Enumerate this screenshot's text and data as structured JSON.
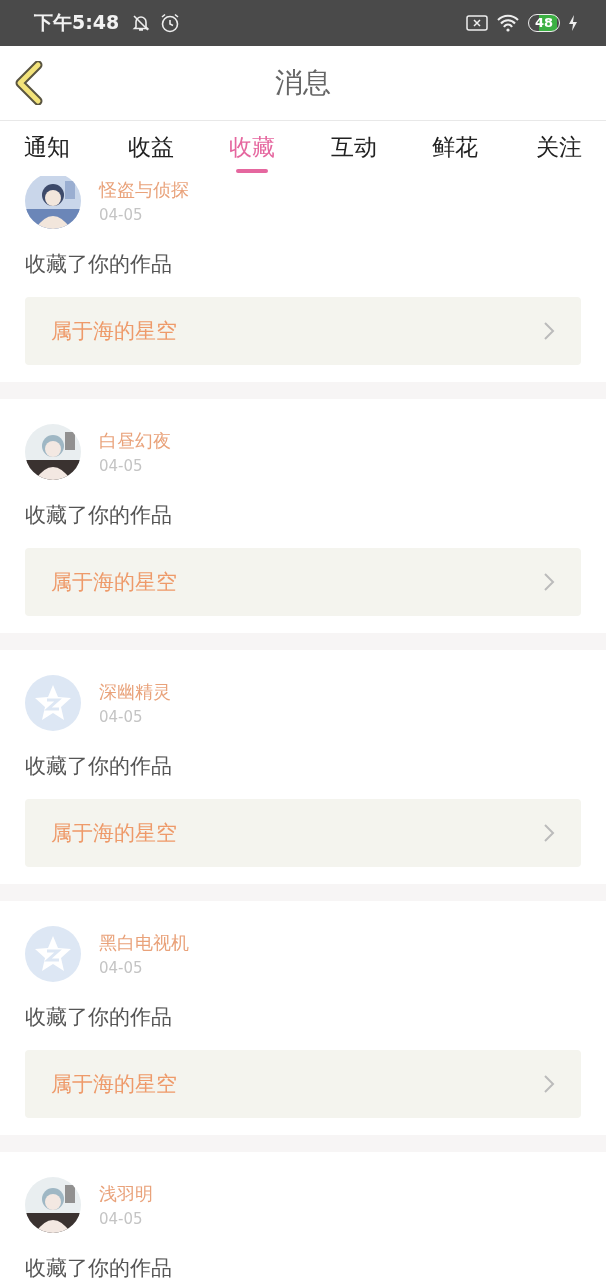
{
  "status_bar": {
    "time": "下午5:48",
    "battery": "48"
  },
  "header": {
    "title": "消息"
  },
  "tabs": [
    {
      "label": "通知",
      "selected": false
    },
    {
      "label": "收益",
      "selected": false
    },
    {
      "label": "收藏",
      "selected": true
    },
    {
      "label": "互动",
      "selected": false
    },
    {
      "label": "鲜花",
      "selected": false
    },
    {
      "label": "关注",
      "selected": false
    }
  ],
  "messages": [
    {
      "name": "怪盗与侦探",
      "date": "04-05",
      "text": "收藏了你的作品",
      "work": "属于海的星空"
    },
    {
      "name": "白昼幻夜",
      "date": "04-05",
      "text": "收藏了你的作品",
      "work": "属于海的星空"
    },
    {
      "avatar": {
        "kind": "default"
      },
      "name": "深幽精灵",
      "date": "04-05",
      "text": "收藏了你的作品",
      "work": "属于海的星空"
    },
    {
      "avatar": {
        "kind": "default"
      },
      "name": "黑白电视机",
      "date": "04-05",
      "text": "收藏了你的作品",
      "work": "属于海的星空"
    },
    {
      "name": "浅羽明",
      "date": "04-05",
      "text": "收藏了你的作品"
    }
  ]
}
